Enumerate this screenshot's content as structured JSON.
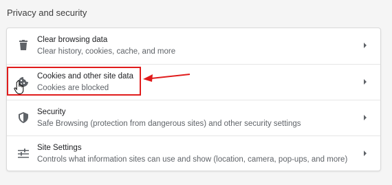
{
  "section": {
    "title": "Privacy and security"
  },
  "rows": [
    {
      "label": "Clear browsing data",
      "sublabel": "Clear history, cookies, cache, and more",
      "icon": "trash-icon"
    },
    {
      "label": "Cookies and other site data",
      "sublabel": "Cookies are blocked",
      "icon": "cookie-icon"
    },
    {
      "label": "Security",
      "sublabel": "Safe Browsing (protection from dangerous sites) and other security settings",
      "icon": "shield-icon"
    },
    {
      "label": "Site Settings",
      "sublabel": "Controls what information sites can use and show (location, camera, pop-ups, and more)",
      "icon": "sliders-icon"
    }
  ],
  "colors": {
    "highlight": "#e01b1b",
    "icon": "#5f6368"
  }
}
